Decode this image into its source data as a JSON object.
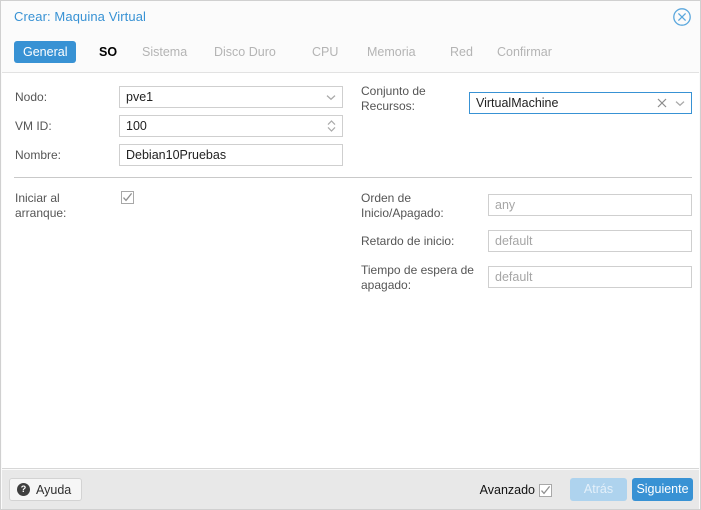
{
  "window": {
    "title": "Crear: Maquina Virtual",
    "close_icon": "close-circle-icon",
    "title_color": "#3892d4"
  },
  "tabs": [
    {
      "label": "General",
      "state": "active"
    },
    {
      "label": "SO",
      "state": "enabled"
    },
    {
      "label": "Sistema",
      "state": "disabled"
    },
    {
      "label": "Disco Duro",
      "state": "disabled"
    },
    {
      "label": "CPU",
      "state": "disabled"
    },
    {
      "label": "Memoria",
      "state": "disabled"
    },
    {
      "label": "Red",
      "state": "disabled"
    },
    {
      "label": "Confirmar",
      "state": "disabled"
    }
  ],
  "form": {
    "left": {
      "node": {
        "label": "Nodo:",
        "value": "pve1",
        "icon": "chevron-down-icon"
      },
      "vmid": {
        "label": "VM ID:",
        "value": "100",
        "icon": "spinner-arrows-icon"
      },
      "name": {
        "label": "Nombre:",
        "value": "Debian10Pruebas"
      },
      "start_at_boot": {
        "label": "Iniciar al arranque:",
        "checked": true
      }
    },
    "right": {
      "resource_pool": {
        "label": "Conjunto de Recursos:",
        "value": "VirtualMachine",
        "focused": true,
        "clear_icon": "close-x-icon",
        "dropdown_icon": "chevron-down-icon"
      },
      "startup_order": {
        "label": "Orden de Inicio/Apagado:",
        "placeholder": "any"
      },
      "startup_delay": {
        "label": "Retardo de inicio:",
        "placeholder": "default"
      },
      "shutdown_timeout": {
        "label": "Tiempo de espera de apagado:",
        "placeholder": "default"
      }
    }
  },
  "footer": {
    "help_label": "Ayuda",
    "help_icon": "question-mark-icon",
    "advanced_label": "Avanzado",
    "advanced_checked": true,
    "back_label": "Atrás",
    "back_disabled": true,
    "next_label": "Siguiente",
    "accent_color": "#3892d4"
  }
}
